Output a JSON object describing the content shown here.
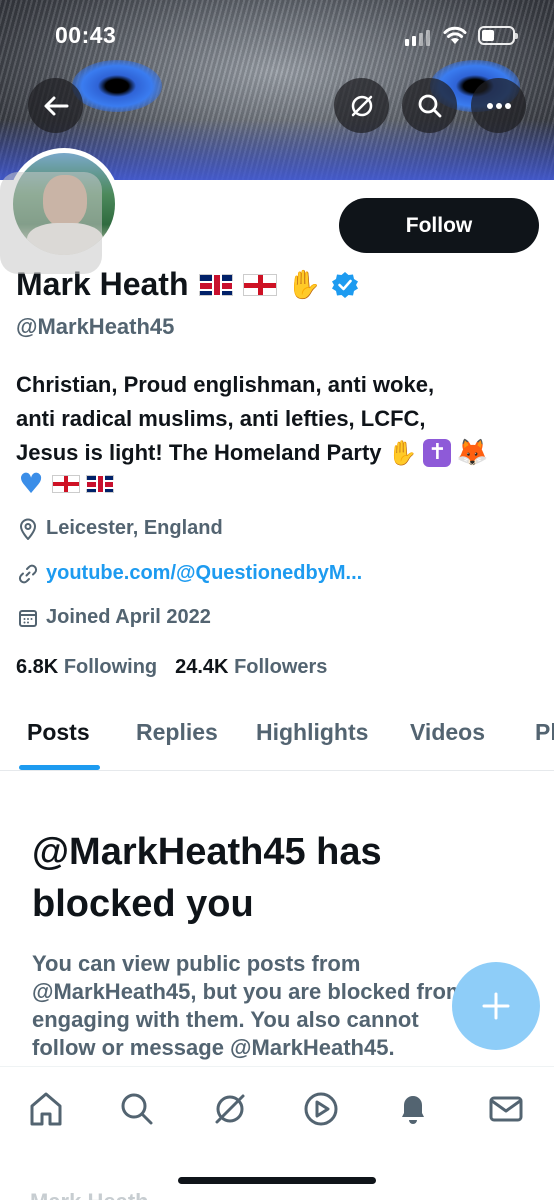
{
  "status_bar": {
    "time": "00:43"
  },
  "header": {
    "back_icon": "arrow-left-icon",
    "grok_icon": "grok-icon",
    "search_icon": "search-icon",
    "more_icon": "more-icon"
  },
  "profile": {
    "follow_label": "Follow",
    "name": "Mark Heath",
    "handle": "@MarkHeath45",
    "bio_line1": "Christian, Proud englishman, anti woke,",
    "bio_line2": "anti radical muslims, anti lefties, LCFC,",
    "bio_line3": "Jesus is light! The Homeland Party",
    "location": "Leicester, England",
    "website": "youtube.com/@QuestionedbyM...",
    "joined": "Joined April 2022",
    "following_count": "6.8K",
    "following_label": "Following",
    "followers_count": "24.4K",
    "followers_label": "Followers"
  },
  "tabs": [
    {
      "label": "Posts"
    },
    {
      "label": "Replies"
    },
    {
      "label": "Highlights"
    },
    {
      "label": "Videos"
    },
    {
      "label": "Pl"
    }
  ],
  "blocked": {
    "title": "@MarkHeath45 has blocked you",
    "body": "You can view public posts from @MarkHeath45, but you are blocked from engaging with them. You also cannot follow or message @MarkHeath45."
  },
  "bottom_nav": [
    "home-icon",
    "search-icon",
    "grok-icon",
    "video-icon",
    "notifications-icon",
    "messages-icon"
  ],
  "peek_text": "Mark Heath",
  "colors": {
    "accent": "#1d9bf0",
    "fab": "#8ecdf8",
    "text_primary": "#0f1419",
    "text_secondary": "#536471"
  }
}
